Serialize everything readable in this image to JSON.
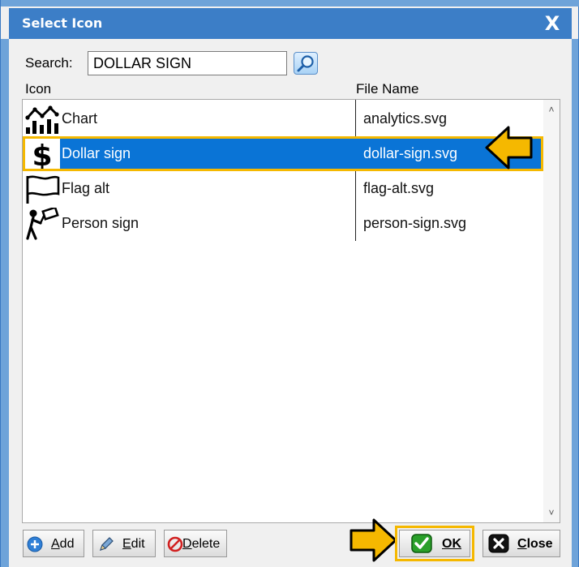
{
  "window": {
    "title": "Select Icon",
    "close_label": "X"
  },
  "search": {
    "label": "Search:",
    "value": "DOLLAR SIGN",
    "button_icon": "search-icon"
  },
  "columns": {
    "icon": "Icon",
    "file_name": "File Name"
  },
  "rows": [
    {
      "name": "Chart",
      "file": "analytics.svg",
      "icon": "analytics-icon",
      "selected": false
    },
    {
      "name": "Dollar sign",
      "file": "dollar-sign.svg",
      "icon": "dollar-sign-icon",
      "selected": true
    },
    {
      "name": "Flag alt",
      "file": "flag-alt.svg",
      "icon": "flag-alt-icon",
      "selected": false
    },
    {
      "name": "Person sign",
      "file": "person-sign.svg",
      "icon": "person-sign-icon",
      "selected": false
    }
  ],
  "buttons": {
    "add": {
      "hotkey": "A",
      "rest": "dd"
    },
    "edit": {
      "hotkey": "E",
      "rest": "dit"
    },
    "delete": {
      "hotkey": "D",
      "rest": "elete"
    },
    "ok": {
      "hotkey": "O",
      "rest": "K"
    },
    "close": {
      "hotkey": "C",
      "rest": "lose"
    }
  },
  "colors": {
    "title_bar": "#3c7ec7",
    "selection": "#0a74d6",
    "highlight": "#f5b800",
    "ok_check": "#2aa02a"
  }
}
